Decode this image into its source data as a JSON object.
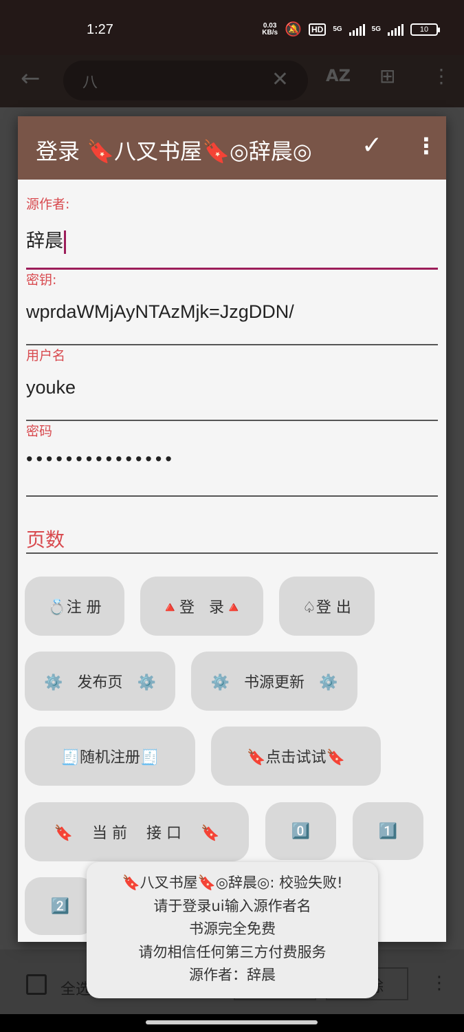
{
  "status_bar": {
    "time": "1:27",
    "net_speed_value": "0.03",
    "net_speed_unit": "KB/s",
    "hd_badge": "HD",
    "sim1_type": "5G",
    "sim2_type": "5G",
    "battery": "10"
  },
  "app_bar": {
    "search_query": "八",
    "sort_label": "AZ"
  },
  "dialog": {
    "title": "登录 🔖八叉书屋🔖◎辞晨◎",
    "fields": [
      {
        "label": "源作者:",
        "value": "辞晨"
      },
      {
        "label": "密钥:",
        "value": "wprdaWMjAyNTAzMjk=JzgDDN/"
      },
      {
        "label": "用户名",
        "value": "youke"
      },
      {
        "label": "密码",
        "value": "•••••••••••••••"
      }
    ],
    "pages_placeholder": "页数",
    "buttons": [
      {
        "label": "💍注 册"
      },
      {
        "label": "🔺登   录🔺"
      },
      {
        "label": "♤登 出"
      },
      {
        "label": "⚙️   发布页   ⚙️"
      },
      {
        "label": "⚙️   书源更新   ⚙️"
      },
      {
        "label": "🧾随机注册🧾"
      },
      {
        "label": "🔖点击试试🔖"
      },
      {
        "label": "🔖    当 前    接 口    🔖"
      },
      {
        "label": "0️⃣"
      },
      {
        "label": "1️⃣"
      },
      {
        "label": "2️⃣"
      }
    ]
  },
  "background": {
    "select_all_label": "全选",
    "delete_label": "除"
  },
  "toast": {
    "lines": [
      "🔖八叉书屋🔖◎辞晨◎: 校验失败!",
      "请于登录ui输入源作者名",
      "书源完全免费",
      "请勿相信任何第三方付费服务",
      "源作者：辞晨"
    ]
  },
  "colors": {
    "header": "#795548",
    "label_red": "#d84a4f",
    "focus_line": "#9c1d5a",
    "chip_bg": "#d9d9d9"
  }
}
